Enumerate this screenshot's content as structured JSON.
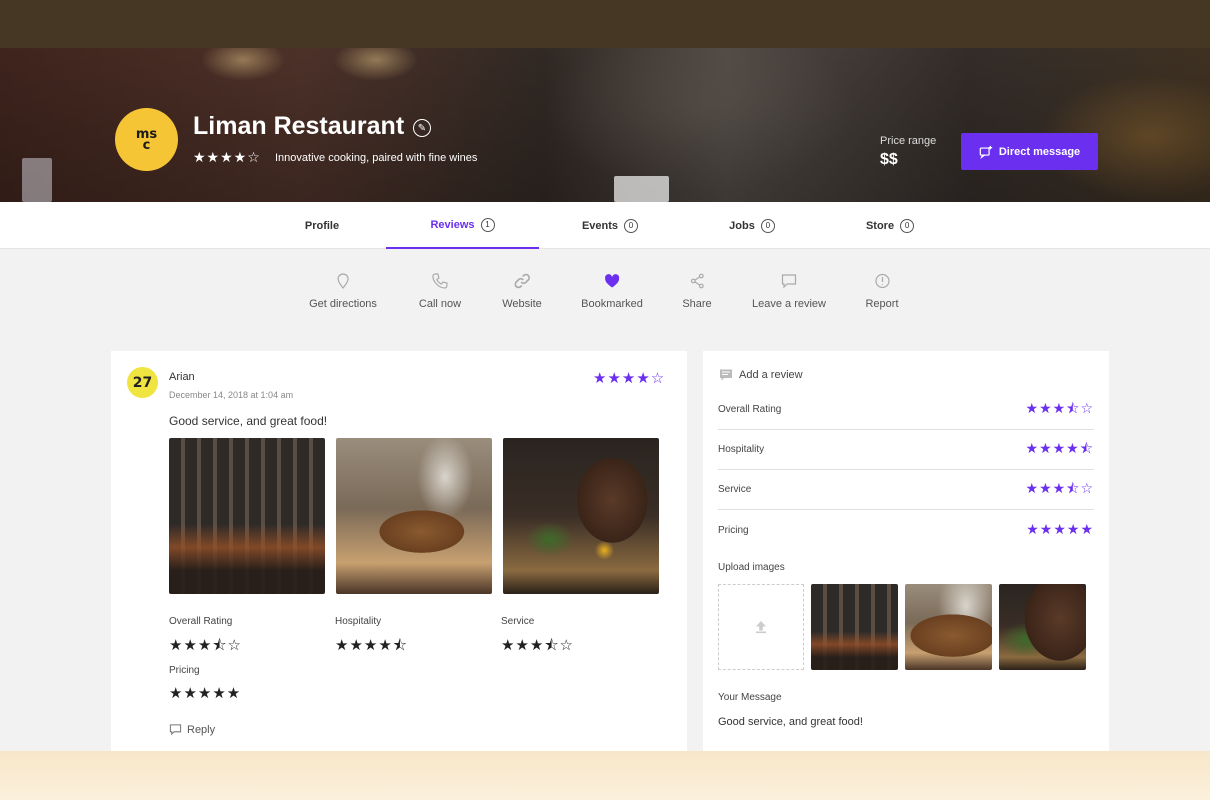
{
  "restaurant": {
    "logo_text": "msc",
    "name": "Liman Restaurant",
    "stars": "★★★★☆",
    "tagline": "Innovative cooking, paired with fine wines",
    "price_label": "Price range",
    "price_value": "$$",
    "direct_message_label": "Direct message"
  },
  "tabs": [
    {
      "label": "Profile",
      "count": ""
    },
    {
      "label": "Reviews",
      "count": "1"
    },
    {
      "label": "Events",
      "count": "0"
    },
    {
      "label": "Jobs",
      "count": "0"
    },
    {
      "label": "Store",
      "count": "0"
    }
  ],
  "actions": [
    {
      "label": "Get directions",
      "icon": "map-pin-icon"
    },
    {
      "label": "Call now",
      "icon": "phone-icon"
    },
    {
      "label": "Website",
      "icon": "link-icon"
    },
    {
      "label": "Bookmarked",
      "icon": "heart-icon"
    },
    {
      "label": "Share",
      "icon": "share-icon"
    },
    {
      "label": "Leave a review",
      "icon": "comment-icon"
    },
    {
      "label": "Report",
      "icon": "info-icon"
    }
  ],
  "review": {
    "avatar_text": "27",
    "author": "Arian",
    "date": "December 14, 2018 at 1:04 am",
    "stars": "★★★★☆",
    "text": "Good service, and great food!",
    "ratings": [
      {
        "label": "Overall Rating",
        "stars": "★★★⯪☆"
      },
      {
        "label": "Hospitality",
        "stars": "★★★★⯪"
      },
      {
        "label": "Service",
        "stars": "★★★⯪☆"
      },
      {
        "label": "Pricing",
        "stars": "★★★★★"
      }
    ],
    "reply_label": "Reply"
  },
  "review_form": {
    "add_review_label": "Add a review",
    "ratings": [
      {
        "label": "Overall Rating",
        "stars": "★★★⯪☆"
      },
      {
        "label": "Hospitality",
        "stars": "★★★★⯪"
      },
      {
        "label": "Service",
        "stars": "★★★⯪☆"
      },
      {
        "label": "Pricing",
        "stars": "★★★★★"
      }
    ],
    "upload_label": "Upload images",
    "message_label": "Your Message",
    "message_value": "Good service, and great food!"
  },
  "colors": {
    "accent": "#6b2ff0",
    "logo_bg": "#f5c535",
    "avatar_bg": "#f0e540"
  }
}
